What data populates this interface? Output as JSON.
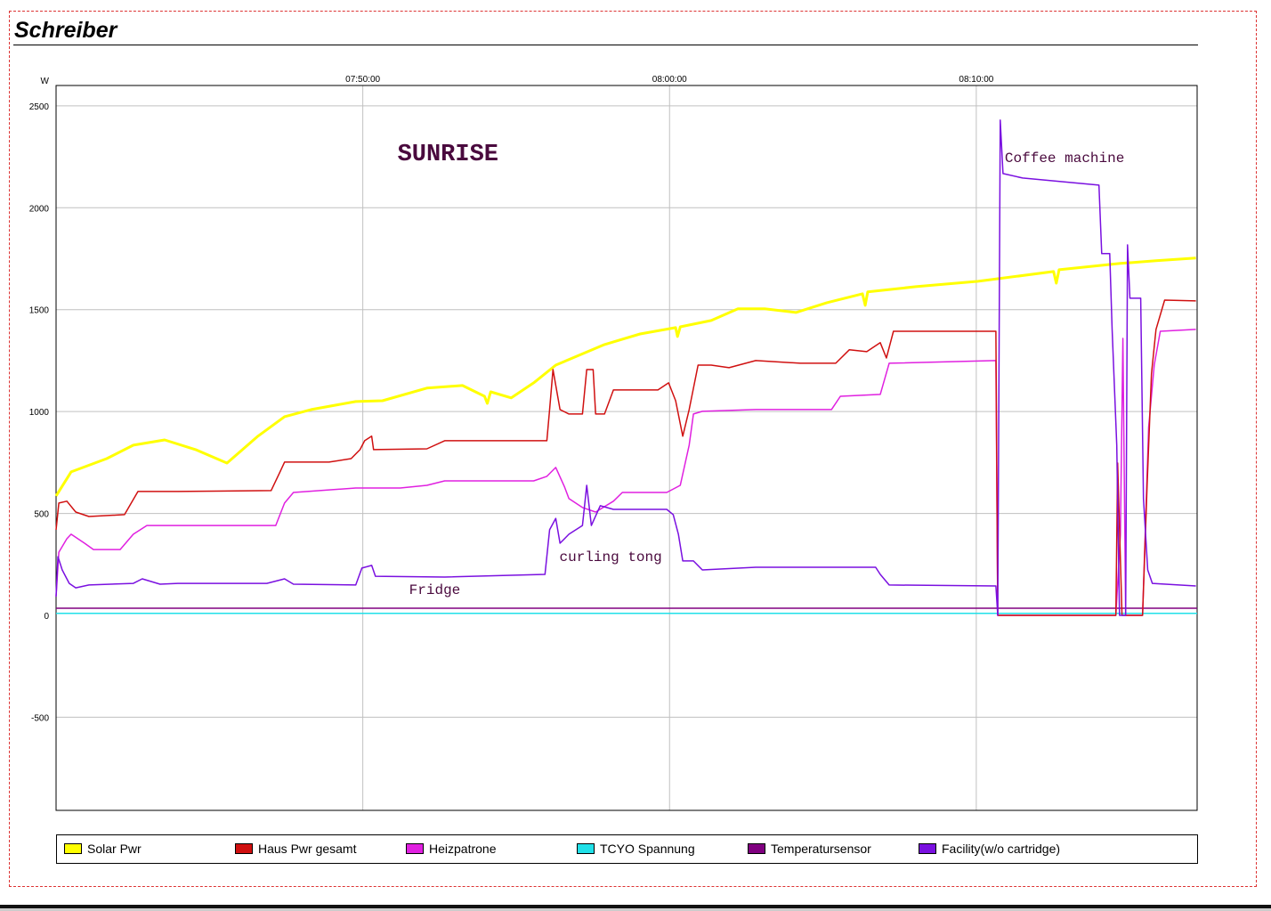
{
  "page": {
    "title": "Schreiber"
  },
  "chart_data": {
    "type": "line",
    "title": "Schreiber",
    "ylabel": "W",
    "xlabel": "",
    "x_unit": "minutes after 07:40:00",
    "xlim": [
      0,
      37.2
    ],
    "ylim": [
      -957,
      2600
    ],
    "grid": true,
    "legend_position": "bottom",
    "x_ticks": [
      {
        "value": 10,
        "label": "07:50:00"
      },
      {
        "value": 20,
        "label": "08:00:00"
      },
      {
        "value": 30,
        "label": "08:10:00"
      }
    ],
    "y_ticks": [
      {
        "value": 2500,
        "label": "2500"
      },
      {
        "value": 2000,
        "label": "2000"
      },
      {
        "value": 1500,
        "label": "1500"
      },
      {
        "value": 1000,
        "label": "1000"
      },
      {
        "value": 500,
        "label": "500"
      },
      {
        "value": 0,
        "label": "0"
      },
      {
        "value": -500,
        "label": "-500"
      }
    ],
    "annotations": [
      {
        "text": "SUNRISE",
        "x": 11.13,
        "y": 2233,
        "size": "large"
      },
      {
        "text": "Coffee machine",
        "x": 30.93,
        "y": 2225,
        "size": "small"
      },
      {
        "text": "curling tong",
        "x": 16.41,
        "y": 267,
        "size": "small"
      },
      {
        "text": "Fridge",
        "x": 11.51,
        "y": 105,
        "size": "small"
      }
    ],
    "annotation_color": "#4a0a3e",
    "series": [
      {
        "name": "Solar Pwr",
        "color": "#ffff00",
        "width": 3,
        "x": [
          0,
          0.49,
          1.65,
          2.52,
          3.54,
          4.55,
          5.57,
          6.58,
          7.45,
          8.32,
          9.77,
          10.64,
          12.09,
          13.25,
          13.97,
          14.06,
          14.17,
          14.84,
          15.57,
          16.29,
          17.88,
          19.04,
          20.2,
          20.26,
          20.35,
          21.36,
          22.23,
          23.1,
          24.12,
          25.13,
          26.29,
          26.38,
          26.46,
          28.03,
          30.06,
          32.52,
          32.61,
          32.7,
          34.7,
          35.86,
          37.16
        ],
        "y": [
          586,
          704,
          769,
          835,
          861,
          813,
          747,
          879,
          975,
          1010,
          1049,
          1053,
          1115,
          1128,
          1075,
          1040,
          1097,
          1067,
          1141,
          1228,
          1329,
          1381,
          1412,
          1368,
          1416,
          1447,
          1504,
          1504,
          1486,
          1534,
          1578,
          1521,
          1587,
          1613,
          1639,
          1687,
          1630,
          1696,
          1727,
          1740,
          1753
        ]
      },
      {
        "name": "Haus Pwr gesamt",
        "color": "#d01010",
        "width": 1.5,
        "x": [
          0,
          0.09,
          0.35,
          0.64,
          1.07,
          2.23,
          2.67,
          3.97,
          7.01,
          7.3,
          7.45,
          8.9,
          9.62,
          9.91,
          10.06,
          10.29,
          10.35,
          12.09,
          12.67,
          14.41,
          16,
          16.09,
          16.2,
          16.43,
          16.72,
          17.16,
          17.3,
          17.51,
          17.59,
          17.88,
          18.17,
          19.62,
          19.97,
          20.2,
          20.43,
          20.64,
          20.93,
          21.36,
          21.94,
          22.81,
          24.26,
          25.42,
          25.86,
          26.43,
          26.87,
          27.07,
          27.3,
          30.64,
          30.7,
          34.55,
          34.61,
          34.75,
          35.42,
          35.57,
          35.71,
          35.86,
          36.14,
          37.16
        ],
        "y": [
          420,
          551,
          560,
          507,
          485,
          494,
          608,
          608,
          612,
          704,
          752,
          752,
          769,
          813,
          857,
          879,
          813,
          817,
          857,
          857,
          857,
          1010,
          1206,
          1010,
          988,
          988,
          1206,
          1206,
          988,
          988,
          1106,
          1106,
          1141,
          1053,
          879,
          1010,
          1228,
          1228,
          1215,
          1250,
          1237,
          1237,
          1303,
          1294,
          1338,
          1263,
          1394,
          1394,
          0,
          0,
          747,
          0,
          0,
          638,
          1185,
          1403,
          1547,
          1543
        ]
      },
      {
        "name": "Heizpatrone",
        "color": "#e020e0",
        "width": 1.5,
        "x": [
          0,
          0.09,
          0.35,
          0.49,
          0.93,
          1.22,
          2.09,
          2.52,
          2.96,
          3.68,
          6.87,
          7.16,
          7.45,
          7.74,
          9.77,
          11.22,
          12.09,
          12.67,
          15.57,
          16,
          16.29,
          16.58,
          16.72,
          17.16,
          17.59,
          18.17,
          18.46,
          19.91,
          20.35,
          20.64,
          20.78,
          21.07,
          22.81,
          25.28,
          25.57,
          26.87,
          27.16,
          30.64,
          30.7,
          34.55,
          34.7,
          34.78,
          34.87,
          35.42,
          35.62,
          35.8,
          36,
          37.16
        ],
        "y": [
          92,
          310,
          376,
          398,
          354,
          323,
          323,
          398,
          441,
          441,
          441,
          441,
          551,
          603,
          625,
          625,
          638,
          660,
          660,
          682,
          726,
          629,
          573,
          529,
          507,
          560,
          603,
          603,
          638,
          835,
          988,
          1001,
          1010,
          1010,
          1075,
          1084,
          1237,
          1250,
          0,
          0,
          398,
          1359,
          0,
          0,
          922,
          1228,
          1394,
          1403
        ]
      },
      {
        "name": "TCYO Spannung",
        "color": "#20e0e8",
        "width": 1.5,
        "x": [
          0,
          37.2
        ],
        "y": [
          10,
          10
        ]
      },
      {
        "name": "Temperatursensor",
        "color": "#800080",
        "width": 1.5,
        "x": [
          0,
          37.2
        ],
        "y": [
          35,
          35
        ]
      },
      {
        "name": "Facility(w/o cartridge)",
        "color": "#7a10e0",
        "width": 1.5,
        "x": [
          0,
          0.06,
          0.2,
          0.43,
          0.64,
          1.07,
          2.52,
          2.81,
          3.39,
          3.97,
          6.87,
          7.45,
          7.74,
          9.77,
          9.97,
          10.29,
          10.41,
          12.67,
          15.94,
          16.09,
          16.29,
          16.43,
          16.72,
          17.16,
          17.3,
          17.45,
          17.74,
          18.17,
          19.91,
          20.12,
          20.29,
          20.43,
          20.78,
          21.07,
          22.81,
          25.42,
          26.72,
          26.87,
          27.16,
          30.64,
          30.7,
          30.78,
          30.87,
          31.51,
          34,
          34.09,
          34.35,
          34.43,
          34.58,
          34.67,
          34.87,
          34.93,
          35.01,
          35.36,
          35.45,
          35.59,
          35.74,
          37.16
        ],
        "y": [
          92,
          288,
          223,
          157,
          135,
          149,
          157,
          179,
          153,
          157,
          157,
          179,
          153,
          149,
          232,
          245,
          192,
          188,
          201,
          420,
          476,
          354,
          398,
          441,
          638,
          441,
          538,
          520,
          520,
          494,
          398,
          267,
          267,
          223,
          236,
          236,
          236,
          201,
          149,
          144,
          0,
          2430,
          2168,
          2146,
          2111,
          1775,
          1775,
          1403,
          835,
          0,
          0,
          1818,
          1556,
          1556,
          573,
          223,
          157,
          144
        ]
      }
    ]
  }
}
